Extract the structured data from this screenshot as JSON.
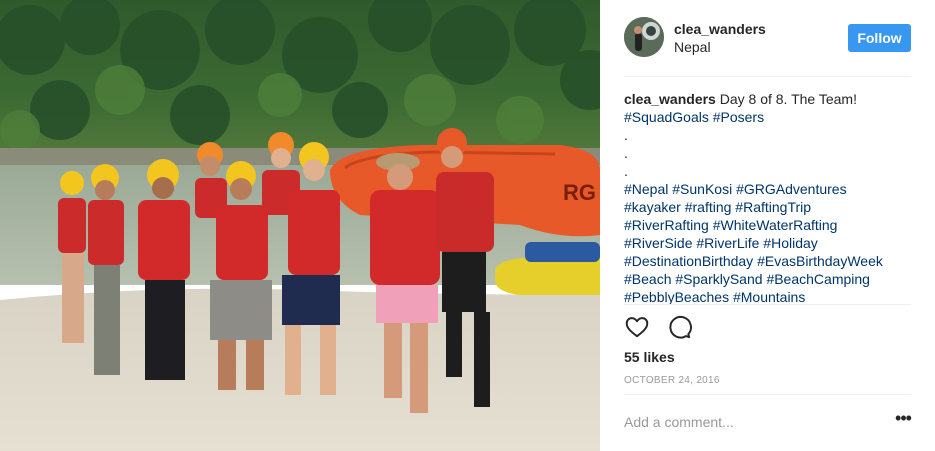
{
  "post": {
    "username": "clea_wanders",
    "location": "Nepal",
    "follow_label": "Follow",
    "caption": {
      "username": "clea_wanders",
      "text": " Day 8 of 8. The Team!",
      "lines": [
        [
          "#SquadGoals",
          "#Posers"
        ],
        [
          "."
        ],
        [
          "."
        ],
        [
          "."
        ],
        [
          "#Nepal",
          "#SunKosi",
          "#GRGAdventures"
        ],
        [
          "#kayaker",
          "#rafting",
          "#RaftingTrip"
        ],
        [
          "#RiverRafting",
          "#WhiteWaterRafting"
        ],
        [
          "#RiverSide",
          "#RiverLife",
          "#Holiday"
        ],
        [
          "#DestinationBirthday",
          "#EvasBirthdayWeek"
        ],
        [
          "#Beach",
          "#SparklySand",
          "#BeachCamping"
        ],
        [
          "#PebblyBeaches",
          "#Mountains"
        ]
      ]
    },
    "likes": "55 likes",
    "date": "OCTOBER 24, 2016",
    "comment_placeholder": "Add a comment...",
    "more_label": "•••"
  },
  "icons": {
    "like": "heart-icon",
    "comment": "comment-bubble-icon",
    "more": "more-options-icon"
  },
  "colors": {
    "follow_button": "#3897f0",
    "hashtag": "#003569",
    "text": "#262626",
    "muted": "#999999",
    "divider": "#efefef"
  },
  "photo": {
    "description_icon": "group-photo",
    "raft_text": "RG"
  }
}
